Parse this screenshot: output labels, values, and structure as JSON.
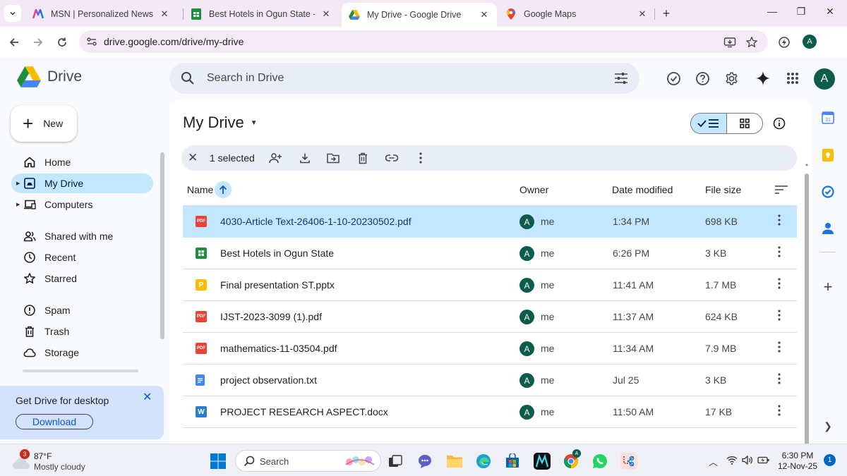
{
  "browser": {
    "tabs": [
      {
        "title": "MSN | Personalized News, Top H",
        "icon": "msn-icon"
      },
      {
        "title": "Best Hotels in Ogun State - Goo",
        "icon": "sheets-icon"
      },
      {
        "title": "My Drive - Google Drive",
        "icon": "drive-icon",
        "active": true
      },
      {
        "title": "Google Maps",
        "icon": "maps-icon"
      }
    ],
    "url": "drive.google.com/drive/my-drive",
    "profile_initial": "A"
  },
  "drive": {
    "logo_text": "Drive",
    "search_placeholder": "Search in Drive",
    "avatar_initial": "A",
    "new_label": "New",
    "nav": [
      {
        "label": "Home",
        "icon": "home-icon"
      },
      {
        "label": "My Drive",
        "icon": "my-drive-icon",
        "active": true
      },
      {
        "label": "Computers",
        "icon": "computer-icon"
      },
      {
        "label": "Shared with me",
        "icon": "people-icon"
      },
      {
        "label": "Recent",
        "icon": "clock-icon"
      },
      {
        "label": "Starred",
        "icon": "star-icon"
      },
      {
        "label": "Spam",
        "icon": "spam-icon"
      },
      {
        "label": "Trash",
        "icon": "trash-icon"
      },
      {
        "label": "Storage",
        "icon": "cloud-icon"
      }
    ],
    "promo": {
      "title": "Get Drive for desktop",
      "button": "Download"
    },
    "page_title": "My Drive",
    "selection": {
      "text": "1 selected"
    },
    "columns": {
      "name": "Name",
      "owner": "Owner",
      "modified": "Date modified",
      "size": "File size"
    },
    "files": [
      {
        "name": "4030-Article Text-26406-1-10-20230502.pdf",
        "type": "pdf",
        "owner_initial": "A",
        "owner": "me",
        "modified": "1:34 PM",
        "size": "698 KB",
        "selected": true
      },
      {
        "name": "Best Hotels in Ogun State",
        "type": "sheets",
        "owner_initial": "A",
        "owner": "me",
        "modified": "6:26 PM",
        "size": "3 KB"
      },
      {
        "name": "Final presentation ST.pptx",
        "type": "slides",
        "owner_initial": "A",
        "owner": "me",
        "modified": "11:41 AM",
        "size": "1.7 MB"
      },
      {
        "name": "IJST-2023-3099 (1).pdf",
        "type": "pdf",
        "owner_initial": "A",
        "owner": "me",
        "modified": "11:37 AM",
        "size": "624 KB"
      },
      {
        "name": "mathematics-11-03504.pdf",
        "type": "pdf",
        "owner_initial": "A",
        "owner": "me",
        "modified": "11:34 AM",
        "size": "7.9 MB"
      },
      {
        "name": "project observation.txt",
        "type": "docs",
        "owner_initial": "A",
        "owner": "me",
        "modified": "Jul 25",
        "size": "3 KB"
      },
      {
        "name": "PROJECT RESEARCH ASPECT.docx",
        "type": "word",
        "owner_initial": "A",
        "owner": "me",
        "modified": "11:50 AM",
        "size": "17 KB"
      }
    ],
    "file_badges": {
      "pdf": "PDF",
      "slides": "P",
      "word": "W"
    }
  },
  "taskbar": {
    "weather_temp": "87°F",
    "weather_desc": "Mostly cloudy",
    "weather_badge": "3",
    "search_placeholder": "Search",
    "time": "6:30 PM",
    "date": "12-Nov-25",
    "notification_count": "1",
    "chrome_profile": "A"
  },
  "colors": {
    "accent": "#0b57d0",
    "selected_row": "#c2e7ff",
    "avatar": "#0b5c4a",
    "pdf": "#ea4335",
    "sheets": "#1e8e3e",
    "slides": "#fbbc04",
    "docs": "#4285f4",
    "word": "#2b7cd3"
  }
}
